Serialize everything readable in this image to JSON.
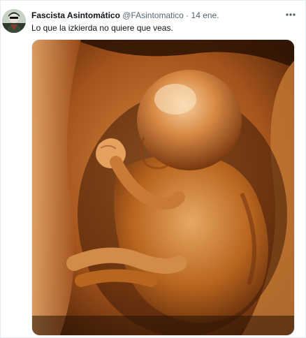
{
  "tweet": {
    "author_name": "Fascista Asintomático",
    "author_handle": "@FAsintomatico",
    "separator": "·",
    "date": "14 ene.",
    "text": "Lo que la izkierda no quiere que veas.",
    "more_icon": "more-horizontal-icon",
    "media_description_icon": "ultrasound-image"
  },
  "colors": {
    "text_primary": "#0f1419",
    "text_secondary": "#536471",
    "border": "#e1e8ed",
    "ultrasound_dark": "#3a1a06",
    "ultrasound_mid": "#b5601f",
    "ultrasound_light": "#f3c38e"
  }
}
